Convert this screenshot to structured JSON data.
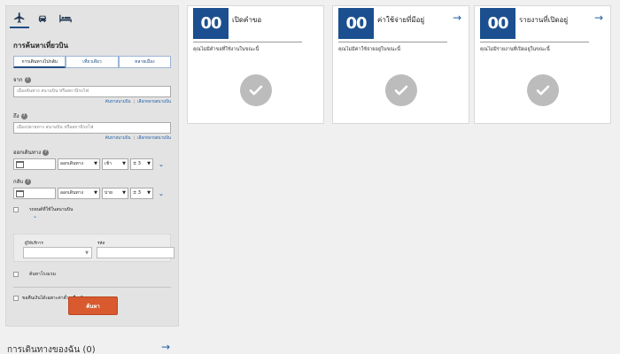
{
  "mode_tabs": [
    {
      "icon": "airplane-icon"
    },
    {
      "icon": "car-icon"
    },
    {
      "icon": "hotel-bed-icon"
    }
  ],
  "search": {
    "title": "การค้นหาเที่ยวบิน",
    "trip_types": [
      "การเดินทางไปกลับ",
      "เที่ยวเดียว",
      "หลายเมือง"
    ],
    "from_label": "จาก",
    "from_placeholder": "เมืองต้นทาง สนามบิน หรือสถานีรถไฟ",
    "to_label": "ถึง",
    "to_placeholder": "เมืองปลายทาง สนามบิน หรือสถานีรถไฟ",
    "link_find_airport": "ค้นหาสนามบิน",
    "link_select_multiple": "เลือกหลายสนามบิน",
    "depart_label": "ออกเดินทาง",
    "return_label": "กลับ",
    "depart_type": "ออกเดินทาง",
    "depart_time": "เช้า",
    "depart_range": "± 3",
    "return_type": "ออกเดินทาง",
    "return_time": "บ่าย",
    "return_range": "± 3",
    "car_option": "รถยนต์ที่ใช้ในสนามบิน",
    "vendor_label": "ผู้ให้บริการ",
    "code_label": "รหัส",
    "hotel_option": "ค้นหาโรงแรม",
    "refundable_option": "ขอคืนเงินได้เฉพาะค่าตั๋วเครื่องบิน",
    "search_button": "ค้นหา"
  },
  "cards": [
    {
      "count": "00",
      "title": "เปิดคำขอ",
      "empty_text": "คุณไม่มีคำขอที่ใช้งานในขณะนี้",
      "has_arrow": false
    },
    {
      "count": "00",
      "title": "ค่าใช้จ่ายที่มีอยู่",
      "empty_text": "คุณไม่มีค่าใช้จ่ายอยู่ในขณะนี้",
      "has_arrow": true
    },
    {
      "count": "00",
      "title": "รายงานที่เปิดอยู่",
      "empty_text": "คุณไม่มีรายงานที่เปิดอยู่ในขณะนี้",
      "has_arrow": true
    }
  ],
  "trips": {
    "title": "การเดินทางของฉัน (0)"
  },
  "colors": {
    "brand_blue": "#1b4f8f",
    "link_blue": "#1f5fa8",
    "search_orange": "#d85a2e",
    "check_gray": "#bcbcbc"
  }
}
